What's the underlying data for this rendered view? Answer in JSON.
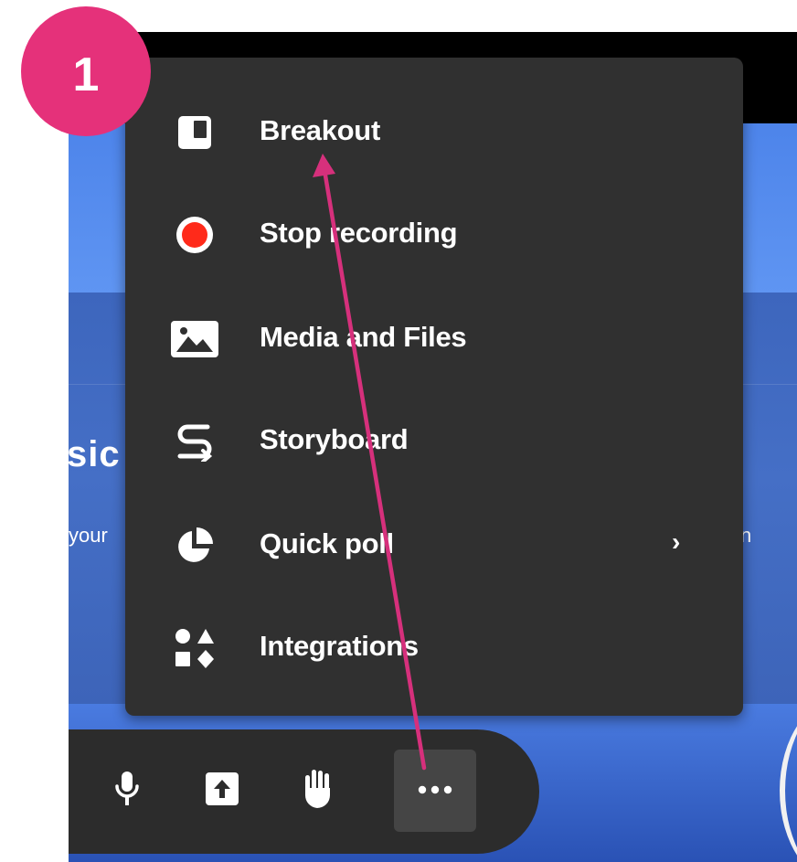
{
  "step_badge": {
    "number": "1"
  },
  "background": {
    "title_fragment": "sic",
    "subtitle_left": "your",
    "subtitle_right": "n"
  },
  "menu": {
    "items": [
      {
        "label": "Breakout",
        "icon": "breakout-icon"
      },
      {
        "label": "Stop recording",
        "icon": "record-icon",
        "icon_color": "#ff2a1a"
      },
      {
        "label": "Media and Files",
        "icon": "image-icon"
      },
      {
        "label": "Storyboard",
        "icon": "storyboard-icon"
      },
      {
        "label": "Quick poll",
        "icon": "pie-chart-icon",
        "submenu_icon": "chevron-right-icon",
        "submenu_glyph": "›"
      },
      {
        "label": "Integrations",
        "icon": "shapes-icon"
      }
    ]
  },
  "toolbar": {
    "buttons": [
      {
        "name": "microphone",
        "icon": "microphone-icon"
      },
      {
        "name": "share",
        "icon": "share-upload-icon"
      },
      {
        "name": "raise-hand",
        "icon": "hand-icon"
      },
      {
        "name": "more",
        "icon": "more-dots-icon",
        "active": true
      }
    ]
  },
  "colors": {
    "accent": "#e5317a",
    "menu_bg": "#303030",
    "toolbar_bg": "#2c2c2c",
    "record_red": "#ff2a1a",
    "annotation_arrow": "#d6307c"
  }
}
